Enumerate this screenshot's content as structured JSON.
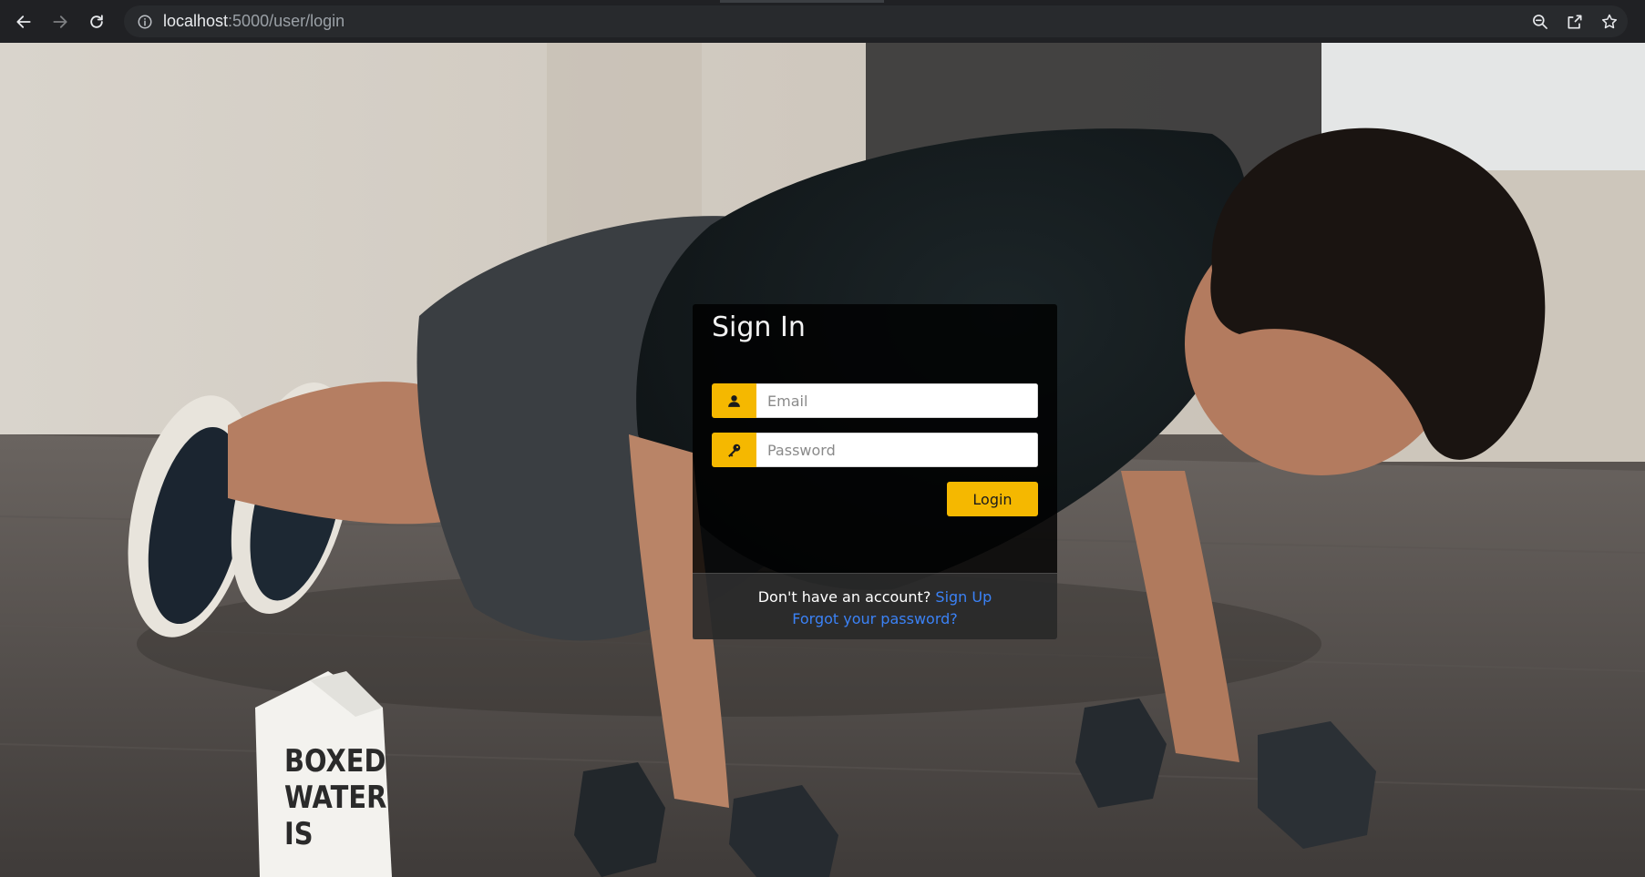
{
  "browser": {
    "url_host": "localhost",
    "url_path": ":5000/user/login",
    "icons": [
      "back-icon",
      "forward-icon",
      "reload-icon",
      "info-icon",
      "zoom-icon",
      "share-icon",
      "star-icon"
    ]
  },
  "hero": {
    "carton_text": "BOXED WATER IS BETTER"
  },
  "login": {
    "title": "Sign In",
    "email_placeholder": "Email",
    "password_placeholder": "Password",
    "login_label": "Login",
    "no_account_text": "Don't have an account?",
    "signup_link": "Sign Up",
    "forgot_link": "Forgot your password?"
  },
  "colors": {
    "accent": "#f5b800",
    "link": "#3b82f6",
    "browser_bar": "#202124"
  }
}
